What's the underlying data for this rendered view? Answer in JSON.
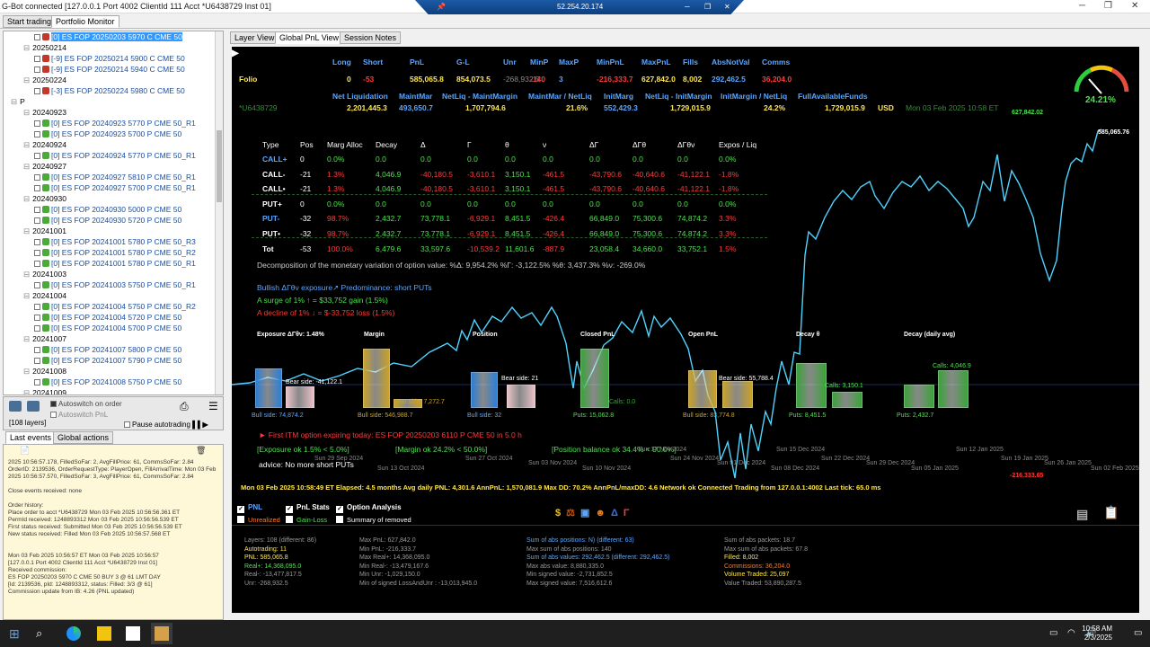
{
  "window": {
    "title": "G-Bot connected [127.0.0.1 Port 4002 ClientId 111 Acct *U6438729 Inst 01]",
    "rdp_ip": "52.254.20.174"
  },
  "app_tabs": [
    "Start trading",
    "Portfolio Monitor"
  ],
  "tree": [
    {
      "t": "[0] ES FOP 20250203 5970 C CME 50",
      "k": "pos",
      "sel": true,
      "lock": "red",
      "ind": 60
    },
    {
      "t": "20250214",
      "k": "date",
      "ind": 48
    },
    {
      "t": "[-9] ES FOP 20250214 5900 C CME 50",
      "k": "pos",
      "lock": "red",
      "ind": 60
    },
    {
      "t": "[-9] ES FOP 20250214 5940 C CME 50",
      "k": "pos",
      "lock": "red",
      "ind": 60
    },
    {
      "t": "20250224",
      "k": "date",
      "ind": 48
    },
    {
      "t": "[-3] ES FOP 20250224 5980 C CME 50",
      "k": "pos",
      "lock": "red",
      "ind": 60
    },
    {
      "t": "P",
      "k": "date",
      "ind": 34
    },
    {
      "t": "20240923",
      "k": "date",
      "ind": 48
    },
    {
      "t": "[0] ES FOP 20240923 5770 P CME 50_R1",
      "k": "pos",
      "ind": 60
    },
    {
      "t": "[0] ES FOP 20240923 5700 P CME 50",
      "k": "pos",
      "ind": 60
    },
    {
      "t": "20240924",
      "k": "date",
      "ind": 48
    },
    {
      "t": "[0] ES FOP 20240924 5770 P CME 50_R1",
      "k": "pos",
      "ind": 60
    },
    {
      "t": "20240927",
      "k": "date",
      "ind": 48
    },
    {
      "t": "[0] ES FOP 20240927 5810 P CME 50_R1",
      "k": "pos",
      "ind": 60
    },
    {
      "t": "[0] ES FOP 20240927 5700 P CME 50_R1",
      "k": "pos",
      "ind": 60
    },
    {
      "t": "20240930",
      "k": "date",
      "ind": 48
    },
    {
      "t": "[0] ES FOP 20240930 5000 P CME 50",
      "k": "pos",
      "ind": 60
    },
    {
      "t": "[0] ES FOP 20240930 5720 P CME 50",
      "k": "pos",
      "ind": 60
    },
    {
      "t": "20241001",
      "k": "date",
      "ind": 48
    },
    {
      "t": "[0] ES FOP 20241001 5780 P CME 50_R3",
      "k": "pos",
      "ind": 60
    },
    {
      "t": "[0] ES FOP 20241001 5780 P CME 50_R2",
      "k": "pos",
      "ind": 60
    },
    {
      "t": "[0] ES FOP 20241001 5780 P CME 50_R1",
      "k": "pos",
      "ind": 60
    },
    {
      "t": "20241003",
      "k": "date",
      "ind": 48
    },
    {
      "t": "[0] ES FOP 20241003 5750 P CME 50_R1",
      "k": "pos",
      "ind": 60
    },
    {
      "t": "20241004",
      "k": "date",
      "ind": 48
    },
    {
      "t": "[0] ES FOP 20241004 5750 P CME 50_R2",
      "k": "pos",
      "ind": 60
    },
    {
      "t": "[0] ES FOP 20241004 5720 P CME 50",
      "k": "pos",
      "ind": 60
    },
    {
      "t": "[0] ES FOP 20241004 5700 P CME 50",
      "k": "pos",
      "ind": 60
    },
    {
      "t": "20241007",
      "k": "date",
      "ind": 48
    },
    {
      "t": "[0] ES FOP 20241007 5800 P CME 50",
      "k": "pos",
      "ind": 60
    },
    {
      "t": "[0] ES FOP 20241007 5790 P CME 50",
      "k": "pos",
      "ind": 60
    },
    {
      "t": "20241008",
      "k": "date",
      "ind": 48
    },
    {
      "t": "[0] ES FOP 20241008 5750 P CME 50",
      "k": "pos",
      "ind": 60
    },
    {
      "t": "20241009",
      "k": "date",
      "ind": 48
    }
  ],
  "left_controls": {
    "autoswitch_order": "Autoswitch on order",
    "autoswitch_pnl": "Autoswitch PnL",
    "layers": "[108 layers]",
    "pause": "Pause autotrading"
  },
  "event_tabs": [
    "Last events",
    "Global actions"
  ],
  "events": [
    "2025 10:56:57.178, FilledSoFar: 2, AvgFillPrice: 61, CommsSoFar: 2.84",
    "OrderID: 2139536, OrderRequestType: PlayerOpen, FillArrivalTime: Mon 03 Feb",
    "2025 10:56:57.570, FilledSoFar: 3, AvgFillPrice: 61, CommsSoFar: 2.84",
    "",
    "Close events received: none",
    "",
    "Order history:",
    "  Place order to acct *U6438729 Mon 03 Feb 2025 10:56:56.361 ET",
    "  PermId received: 1248893312 Mon 03 Feb 2025 10:56:56.539 ET",
    "  First status received: Submitted Mon 03 Feb 2025 10:56:56.539 ET",
    "  New status received: Filled Mon 03 Feb 2025 10:56:57.568 ET",
    "",
    "",
    "Mon 03 Feb 2025 10:56:57 ET  Mon 03 Feb 2025 10:56:57",
    "[127.0.0.1 Port 4002 ClientId 111 Acct *U6438729 Inst 01]",
    "Received commission:",
    "ES FOP 20250203 5970 C CME 50 BUY 3 @ 61 LMT DAY",
    "[Id: 2139536, pId: 1248893312, status: Filled: 3/3 @ 61]",
    "Commission update from IB: 4.26 (PNL updated)"
  ],
  "view_tabs": [
    "Layer View",
    "Global PnL View",
    "Session Notes"
  ],
  "top_headers": [
    "Long",
    "Short",
    "PnL",
    "G-L",
    "Unr",
    "MinP",
    "MaxP",
    "MinPnL",
    "MaxPnL",
    "Fills",
    "AbsNotVal",
    "Comms"
  ],
  "folio_label": "Folio",
  "folio_values": [
    "0",
    "-53",
    "585,065.8",
    "854,073.5",
    "-268,932.5",
    "-140",
    "3",
    "-216,333.7",
    "627,842.0",
    "8,002",
    "292,462.5",
    "36,204.0"
  ],
  "acct_headers": [
    "Net Liquidation",
    "MaintMar",
    "NetLiq - MaintMargin",
    "MaintMar / NetLiq",
    "InitMarg",
    "NetLiq - InitMargin",
    "InitMargin / NetLiq",
    "FullAvailableFunds"
  ],
  "acct_label": "*U6438729",
  "acct_values": [
    "2,201,445.3",
    "493,650.7",
    "1,707,794.6",
    "21.6%",
    "552,429.3",
    "1,729,015.9",
    "24.2%",
    "1,729,015.9"
  ],
  "currency": "USD",
  "acct_time": "Mon 03 Feb 2025 10:58 ET",
  "greeks_headers": [
    "Type",
    "Pos",
    "Marg Alloc",
    "Decay",
    "Δ",
    "Γ",
    "θ",
    "ν",
    "ΔΓ",
    "ΔΓθ",
    "ΔΓθν",
    "Expos / Liq"
  ],
  "greeks_rows": [
    {
      "type": "CALL+",
      "vals": [
        "0",
        "0.0%",
        "0.0",
        "0.0",
        "0.0",
        "0.0",
        "0.0",
        "0.0",
        "0.0",
        "0.0",
        "0.0%"
      ],
      "tc": "hdr",
      "vc": "wht"
    },
    {
      "type": "CALL-",
      "vals": [
        "-21",
        "1.3%",
        "4,046.9",
        "-40,180.5",
        "-3,610.1",
        "3,150.1",
        "-461.5",
        "-43,790.6",
        "-40,640.6",
        "-41,122.1",
        "-1.8%"
      ],
      "tc": "wht",
      "vc": "mix"
    },
    {
      "type": "CALL•",
      "vals": [
        "-21",
        "1.3%",
        "4,046.9",
        "-40,180.5",
        "-3,610.1",
        "3,150.1",
        "-461.5",
        "-43,790.6",
        "-40,640.6",
        "-41,122.1",
        "-1.8%"
      ],
      "tc": "wht",
      "vc": "mix"
    },
    {
      "type": "PUT+",
      "vals": [
        "0",
        "0.0%",
        "0.0",
        "0.0",
        "0.0",
        "0.0",
        "0.0",
        "0.0",
        "0.0",
        "0.0",
        "0.0%"
      ],
      "tc": "wht",
      "vc": "wht"
    },
    {
      "type": "PUT-",
      "vals": [
        "-32",
        "98.7%",
        "2,432.7",
        "73,778.1",
        "-6,929.1",
        "8,451.5",
        "-426.4",
        "66,849.0",
        "75,300.6",
        "74,874.2",
        "3.3%"
      ],
      "tc": "hdr",
      "vc": "mix"
    },
    {
      "type": "PUT•",
      "vals": [
        "-32",
        "98.7%",
        "2,432.7",
        "73,778.1",
        "-6,929.1",
        "8,451.5",
        "-426.4",
        "66,849.0",
        "75,300.6",
        "74,874.2",
        "3.3%"
      ],
      "tc": "wht",
      "vc": "mix"
    },
    {
      "type": "Tot",
      "vals": [
        "-53",
        "100.0%",
        "6,479.6",
        "33,597.6",
        "-10,539.2",
        "11,601.6",
        "-887.9",
        "23,058.4",
        "34,660.0",
        "33,752.1",
        "1.5%"
      ],
      "tc": "wht",
      "vc": "mix"
    }
  ],
  "decomposition": "Decomposition of the monetary variation of option value: %Δ: 9,954.2% %Γ: -3,122.5% %θ: 3,437.3% %ν: -269.0%",
  "exposure_line": "Bullish ΔΓθν exposure↗ Predominance:  short PUTs",
  "surge_line": "A surge of 1% ↑ = $33,752 gain (1.5%)",
  "decline_line": "A decline of 1% ↓ = $-33,752 loss (1.5%)",
  "gauge_pct": "24.21%",
  "max_label": "627,842.02",
  "last_label": "585,065.76",
  "min_label": "-216,333.65",
  "bar_groups": [
    "Exposure ΔΓθν: 1.48%",
    "Margin",
    "Position",
    "Closed PnL",
    "Open PnL",
    "Decay θ",
    "Decay (daily avg)"
  ],
  "bar_labels": {
    "exp_bear": "Bear side: -41,122.1",
    "exp_bull": "Bull side: 74,874.2",
    "mar_bear": "Bear side: 7,272.7",
    "mar_bull": "Bull side: 546,988.7",
    "pos_bear": "Bear side: 21",
    "pos_bull": "Bull side: 32",
    "cl_calls": "Calls: 0.0",
    "cl_puts": "Puts: 15,062.8",
    "op_bear": "Bear side: 55,788.4",
    "op_bull": "Bull side: 83,774.8",
    "dec_calls": "Calls: 3,150.1",
    "dec_puts": "Puts: 8,451.5",
    "da_calls": "Calls: 4,046.9",
    "da_puts": "Puts: 2,432.7"
  },
  "itm_warning": "► First ITM option expiring today: ES FOP 20250203 6110 P CME 50 in 5.0 h",
  "checks": [
    "[Exposure ok 1.5% < 5.0%]",
    "[Margin ok 24.2% < 50.0%]",
    "[Position balance ok 34.4% < 90.0%]"
  ],
  "advice": "advice: No more short PUTs",
  "date_ticks": [
    "Sun 29 Sep 2024",
    "Sun 13 Oct 2024",
    "Sun 27 Oct 2024",
    "Sun 03 Nov 2024",
    "Sun 10 Nov 2024",
    "Sun 17 Nov 2024",
    "Sun 24 Nov 2024",
    "Sun 01 Dec 2024",
    "Sun 08 Dec 2024",
    "Sun 15 Dec 2024",
    "Sun 22 Dec 2024",
    "Sun 29 Dec 2024",
    "Sun 05 Jan 2025",
    "Sun 12 Jan 2025",
    "Sun 19 Jan 2025",
    "Sun 26 Jan 2025",
    "Sun 02 Feb 2025"
  ],
  "status_bar": "Mon 03 Feb 2025 10:58:49 ET   Elapsed: 4.5 months   Avg daily PNL: 4,301.6   AnnPnL: 1,570,081.9   Max DD: 70.2%   AnnPnL/maxDD: 4.6   Network ok   Connected   Trading from 127.0.0.1:4002   Last tick: 65.0 ms",
  "toggles": [
    {
      "label": "PNL",
      "on": true,
      "color": "#5aa6ff"
    },
    {
      "label": "PnL Stats",
      "on": true,
      "color": "#ffffff"
    },
    {
      "label": "Option Analysis",
      "on": true,
      "color": "#ffffff"
    },
    {
      "label": "Unrealized",
      "on": false,
      "color": "#ff7a2a"
    },
    {
      "label": "Gain-Loss",
      "on": false,
      "color": "#4ee34e"
    },
    {
      "label": "Summary of removed",
      "on": false,
      "color": "#ffffff"
    }
  ],
  "stats": [
    [
      {
        "t": "Layers: 108 (different: 86)",
        "c": "#9a9a9a"
      },
      {
        "t": "Autotrading: 11",
        "c": "#ffe74a"
      },
      {
        "t": "PNL: 585,065.8",
        "c": "#ffe74a"
      },
      {
        "t": "Real+: 14,368,095.0",
        "c": "#4ee34e"
      },
      {
        "t": "Real-: -13,477,817.5",
        "c": "#9a9a9a"
      },
      {
        "t": "Unr: -268,932.5",
        "c": "#9a9a9a"
      }
    ],
    [
      {
        "t": "Max PnL: 627,842.0",
        "c": "#9a9a9a"
      },
      {
        "t": "Min PnL: -216,333.7",
        "c": "#9a9a9a"
      },
      {
        "t": "Max Real+: 14,368,095.0",
        "c": "#9a9a9a"
      },
      {
        "t": "Min Real-: -13,479,167.6",
        "c": "#9a9a9a"
      },
      {
        "t": "Min Unr: -1,029,150.0",
        "c": "#9a9a9a"
      },
      {
        "t": "Min of signed LossAndUnr : -13,013,945.0",
        "c": "#9a9a9a"
      }
    ],
    [
      {
        "t": "Sum of abs positions: N) (different: 63)",
        "c": "#5aa6ff"
      },
      {
        "t": "Max sum of abs positions: 140",
        "c": "#9a9a9a"
      },
      {
        "t": "Sum of abs values: 292,462.5 (different: 292,462.5)",
        "c": "#5aa6ff"
      },
      {
        "t": "Max abs value: 8,880,335.0",
        "c": "#9a9a9a"
      },
      {
        "t": "Min signed value: -2,731,852.5",
        "c": "#9a9a9a"
      },
      {
        "t": "Max signed value: 7,516,612.6",
        "c": "#9a9a9a"
      }
    ],
    [
      {
        "t": "Sum of abs packets: 18.7",
        "c": "#9a9a9a"
      },
      {
        "t": "Max sum of abs packets: 67.8",
        "c": "#9a9a9a"
      },
      {
        "t": "Filled: 8,002",
        "c": "#ffe74a"
      },
      {
        "t": "Commissions: 36,204.0",
        "c": "#ff7a2a"
      },
      {
        "t": "Volume Traded: 25,097",
        "c": "#ffe74a"
      },
      {
        "t": "Value Traded: 53,890,287.5",
        "c": "#9a9a9a"
      }
    ]
  ],
  "clock": {
    "time": "10:58 AM",
    "date": "2/3/2025"
  }
}
